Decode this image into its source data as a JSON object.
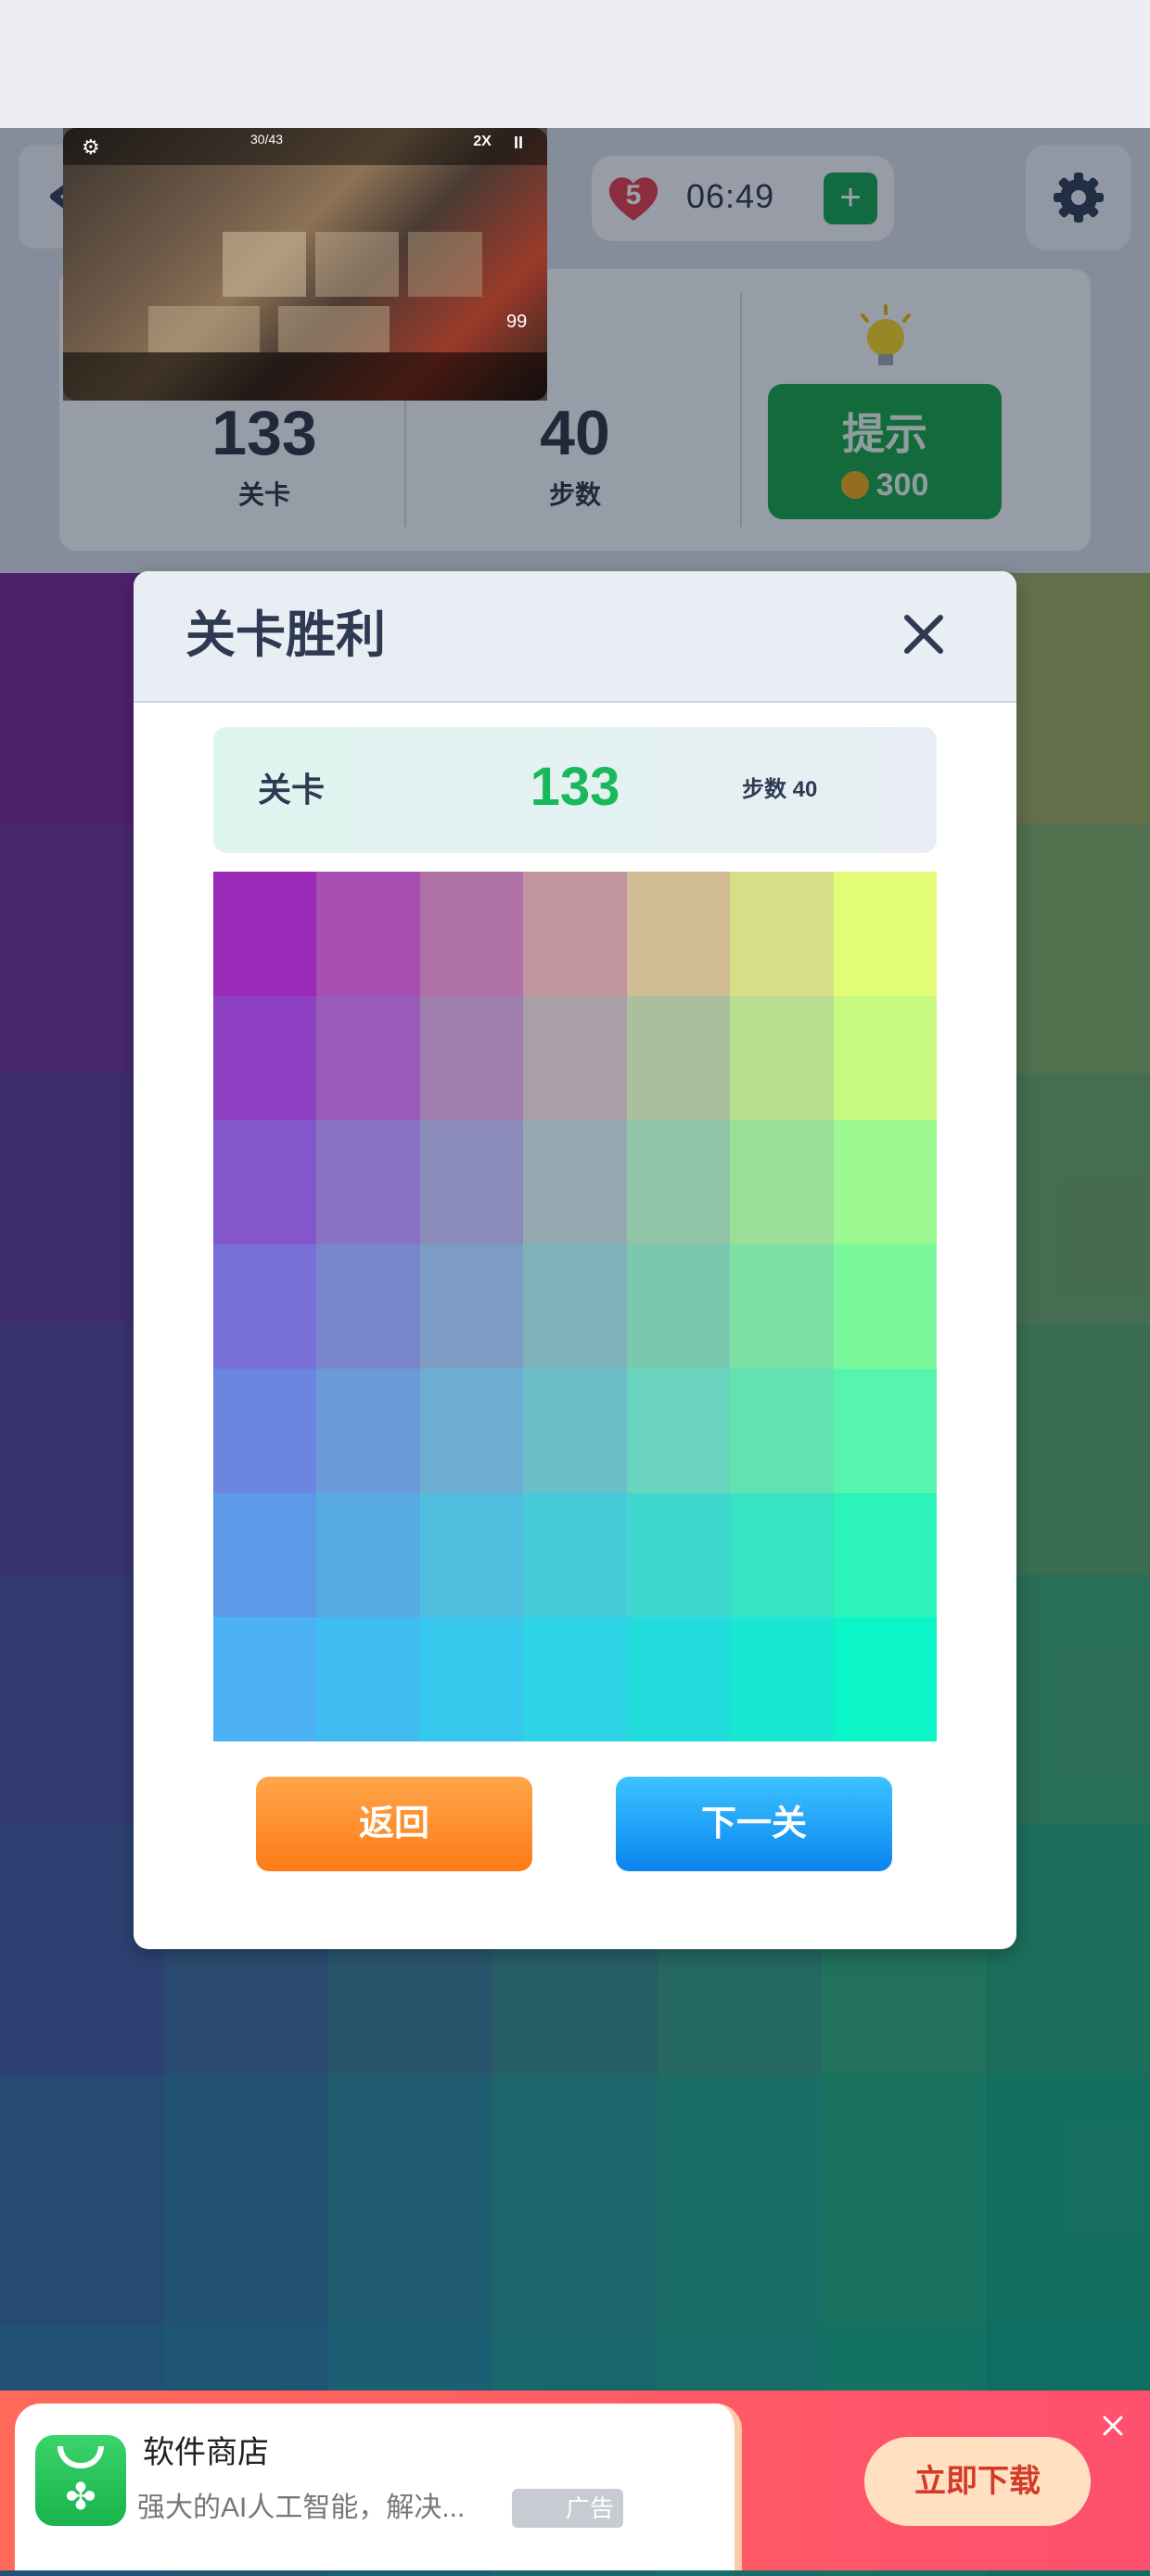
{
  "header": {
    "lives": "5",
    "timer": "06:49",
    "add_label": "+",
    "level_value": "133",
    "level_label": "关卡",
    "steps_value": "40",
    "steps_label": "步数",
    "hint_label": "提示",
    "hint_cost": "300"
  },
  "video_overlay": {
    "counter": "30/43",
    "speed": "2X",
    "pause": "II",
    "score": "99"
  },
  "modal": {
    "title": "关卡胜利",
    "level_label": "关卡",
    "level_value": "133",
    "steps_text": "步数 40",
    "back_button": "返回",
    "next_button": "下一关"
  },
  "win_board_colors": [
    [
      "#9c2ab8",
      "#a64fb1",
      "#b071a4",
      "#c2949e",
      "#d0bc94",
      "#d6de88",
      "#e2fc78"
    ],
    [
      "#8e40c2",
      "#9a5cba",
      "#a07eae",
      "#a8a0a6",
      "#acbf9c",
      "#b8de90",
      "#c8fa80"
    ],
    [
      "#8458cc",
      "#8a72c4",
      "#8c8cba",
      "#94a8b0",
      "#90c4a6",
      "#9ade98",
      "#9cf890"
    ],
    [
      "#7870d6",
      "#7a86cc",
      "#7c9cc4",
      "#7eb2ba",
      "#7ac8b0",
      "#7ce0a4",
      "#7cf89c"
    ],
    [
      "#6c86e0",
      "#6c9ad8",
      "#6eaed2",
      "#6cbec8",
      "#6ad4be",
      "#62e2b0",
      "#56f4ac"
    ],
    [
      "#5c9ae8",
      "#58aae2",
      "#50bcde",
      "#46cad8",
      "#40d8ce",
      "#36e4c2",
      "#2cf4b8"
    ],
    [
      "#4cb2f4",
      "#40bcf0",
      "#36c8ec",
      "#2cd4e6",
      "#22dcdc",
      "#18e8d2",
      "#0af6c8"
    ]
  ],
  "bg_board_colors": [
    [
      "#7a2396",
      "#83378f",
      "#8e4a88",
      "#996285",
      "#a87d78",
      "#b49a6a",
      "#9eab5c"
    ],
    [
      "#6d2f98",
      "#74408f",
      "#7c5288",
      "#84687e",
      "#8a8a72",
      "#8fa466",
      "#7cab62"
    ],
    [
      "#5f3a9a",
      "#634a92",
      "#6a5a8a",
      "#6e6e80",
      "#728678",
      "#769c6e",
      "#68a568"
    ],
    [
      "#55449c",
      "#575696",
      "#5a6a8e",
      "#5b7e86",
      "#5e947e",
      "#5ca674",
      "#57a66c"
    ],
    [
      "#4a4f9e",
      "#495e98",
      "#4a7090",
      "#488488",
      "#46987e",
      "#44a874",
      "#3aa872"
    ],
    [
      "#3e5aa0",
      "#3c6a9c",
      "#3a7c96",
      "#368c8e",
      "#329e84",
      "#2eac7a",
      "#24a87a"
    ],
    [
      "#336aa4",
      "#2e78a0",
      "#2a889c",
      "#269a94",
      "#22a88a",
      "#1eae82",
      "#16a880"
    ],
    [
      "#2c76a8",
      "#287ea4",
      "#238ea0",
      "#1e9c98",
      "#1aa890",
      "#14ae88",
      "#0ca886"
    ]
  ],
  "ad": {
    "title": "软件商店",
    "description": "强大的AI人工智能，解决...",
    "tag": "广告",
    "download": "立即下载",
    "brand_color": "#ff5a64"
  },
  "icons": {
    "back": "chevron-left-icon",
    "heart": "heart-icon",
    "settings": "gear-icon",
    "bulb": "lightbulb-icon",
    "coin": "coin-icon",
    "close": "close-icon",
    "ad_close": "close-icon"
  }
}
